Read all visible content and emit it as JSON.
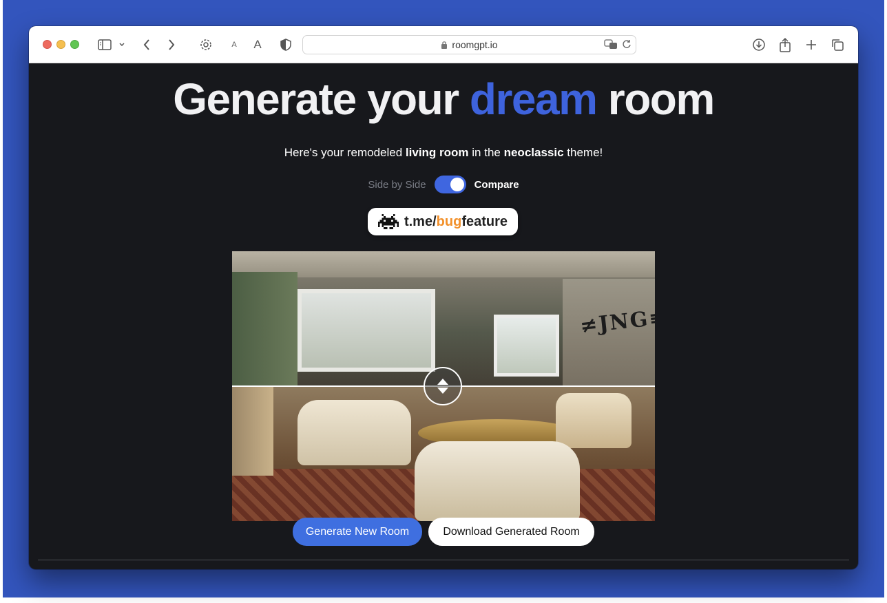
{
  "browser": {
    "url": "roomgpt.io",
    "text_size_small": "A",
    "text_size_large": "A"
  },
  "hero": {
    "title_part1": "Generate your ",
    "title_accent": "dream",
    "title_part2": " room",
    "accent_color": "#3e63dd"
  },
  "subtitle": {
    "part1": "Here's your remodeled ",
    "room_type": "living room",
    "part2": " in the ",
    "theme": "neoclassic",
    "part3": " theme!"
  },
  "toggle": {
    "off_label": "Side by Side",
    "on_label": "Compare",
    "state": "on"
  },
  "watermark": {
    "text_prefix": "t.me/",
    "text_highlight": "bug",
    "text_suffix": "feature"
  },
  "compare_view": {
    "top_image": "original room (damaged, graffiti)",
    "bottom_image": "generated neoclassic living room"
  },
  "actions": {
    "generate_label": "Generate New Room",
    "download_label": "Download Generated Room"
  },
  "colors": {
    "page_bg": "#17181c",
    "primary_button": "#3f6fe0",
    "desktop_bg": "#3355bd"
  }
}
